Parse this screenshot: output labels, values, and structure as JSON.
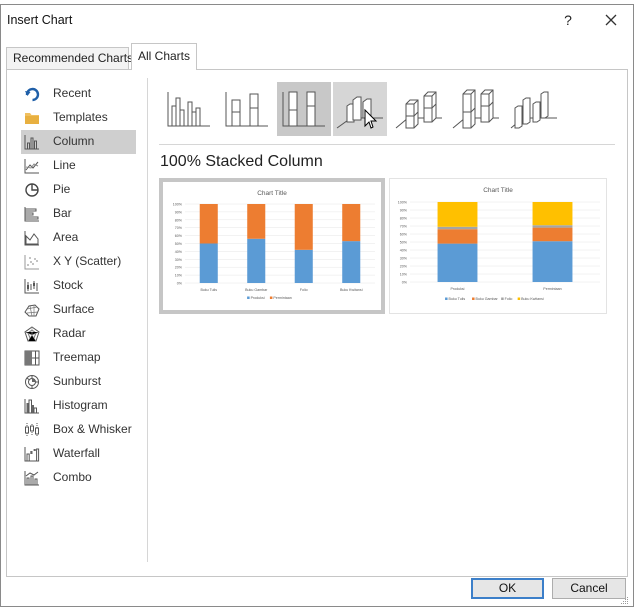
{
  "dialog": {
    "title": "Insert Chart",
    "help_label": "?"
  },
  "tabs": [
    {
      "label": "Recommended Charts",
      "active": false
    },
    {
      "label": "All Charts",
      "active": true
    }
  ],
  "sidebar": {
    "items": [
      {
        "label": "Recent",
        "icon": "recent-icon"
      },
      {
        "label": "Templates",
        "icon": "folder-icon"
      },
      {
        "label": "Column",
        "icon": "column-chart-icon",
        "selected": true
      },
      {
        "label": "Line",
        "icon": "line-chart-icon"
      },
      {
        "label": "Pie",
        "icon": "pie-chart-icon"
      },
      {
        "label": "Bar",
        "icon": "bar-chart-icon"
      },
      {
        "label": "Area",
        "icon": "area-chart-icon"
      },
      {
        "label": "X Y (Scatter)",
        "icon": "scatter-chart-icon"
      },
      {
        "label": "Stock",
        "icon": "stock-chart-icon"
      },
      {
        "label": "Surface",
        "icon": "surface-chart-icon"
      },
      {
        "label": "Radar",
        "icon": "radar-chart-icon"
      },
      {
        "label": "Treemap",
        "icon": "treemap-icon"
      },
      {
        "label": "Sunburst",
        "icon": "sunburst-icon"
      },
      {
        "label": "Histogram",
        "icon": "histogram-icon"
      },
      {
        "label": "Box & Whisker",
        "icon": "box-whisker-icon"
      },
      {
        "label": "Waterfall",
        "icon": "waterfall-icon"
      },
      {
        "label": "Combo",
        "icon": "combo-chart-icon"
      }
    ]
  },
  "subtypes": {
    "selected_index": 2,
    "hover_index": 3,
    "items": [
      "clustered-column",
      "stacked-column",
      "100-stacked-column",
      "3d-clustered-column",
      "3d-stacked-column",
      "3d-100-stacked-column",
      "3d-column"
    ]
  },
  "chart_type_name": "100% Stacked Column",
  "previews": [
    {
      "selected": true,
      "chart_data": {
        "type": "bar",
        "stacking": "percent",
        "title": "Chart Title",
        "categories": [
          "Buku Tulis",
          "Buku Gambar",
          "Folio",
          "Buku Kwitansi"
        ],
        "series": [
          {
            "name": "Produksi",
            "color": "#5b9bd5",
            "values": [
              50,
              56,
              42,
              53
            ]
          },
          {
            "name": "Permintaan",
            "color": "#ed7d31",
            "values": [
              50,
              44,
              58,
              47
            ]
          }
        ],
        "ylim": [
          0,
          100
        ],
        "yticks": [
          "100%",
          "90%",
          "80%",
          "70%",
          "60%",
          "50%",
          "40%",
          "30%",
          "20%",
          "10%",
          "0%"
        ],
        "grid": true,
        "legend": "bottom"
      }
    },
    {
      "selected": false,
      "chart_data": {
        "type": "bar",
        "stacking": "percent",
        "title": "Chart Title",
        "categories": [
          "Produksi",
          "Permintaan"
        ],
        "series": [
          {
            "name": "Buku Tulis",
            "color": "#5b9bd5",
            "values": [
              48,
              51
            ]
          },
          {
            "name": "Buku Gambar",
            "color": "#ed7d31",
            "values": [
              18,
              17
            ]
          },
          {
            "name": "Folio",
            "color": "#a5a5a5",
            "values": [
              3,
              3
            ]
          },
          {
            "name": "Buku Kwitansi",
            "color": "#ffc000",
            "values": [
              31,
              29
            ]
          }
        ],
        "ylim": [
          0,
          100
        ],
        "yticks": [
          "100%",
          "90%",
          "80%",
          "70%",
          "60%",
          "50%",
          "40%",
          "30%",
          "20%",
          "10%",
          "0%"
        ],
        "grid": true,
        "legend": "bottom"
      }
    }
  ],
  "footer": {
    "ok_label": "OK",
    "cancel_label": "Cancel"
  },
  "colors": {
    "accent": "#3c7fc9",
    "selection_gray": "#cfcfcf",
    "icon_dark": "#555555",
    "icon_blue": "#1f5fa8",
    "icon_folder": "#f0c060"
  }
}
